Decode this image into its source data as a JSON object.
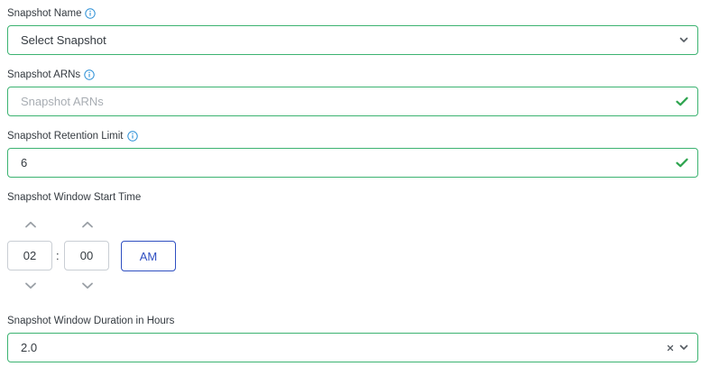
{
  "snapshot_name": {
    "label": "Snapshot Name",
    "placeholder": "Select Snapshot"
  },
  "snapshot_arns": {
    "label": "Snapshot ARNs",
    "placeholder": "Snapshot ARNs",
    "value": ""
  },
  "retention_limit": {
    "label": "Snapshot Retention Limit",
    "value": "6"
  },
  "window_start_time": {
    "label": "Snapshot Window Start Time",
    "hour": "02",
    "separator": ":",
    "minute": "00",
    "period": "AM"
  },
  "window_duration": {
    "label": "Snapshot Window Duration in Hours",
    "value": "2.0"
  },
  "colors": {
    "valid_border": "#3cb371",
    "checkmark": "#2ea44f",
    "info_icon": "#2b8fd6",
    "am_button": "#2f4fc1",
    "chevron": "#9aa0a6"
  }
}
